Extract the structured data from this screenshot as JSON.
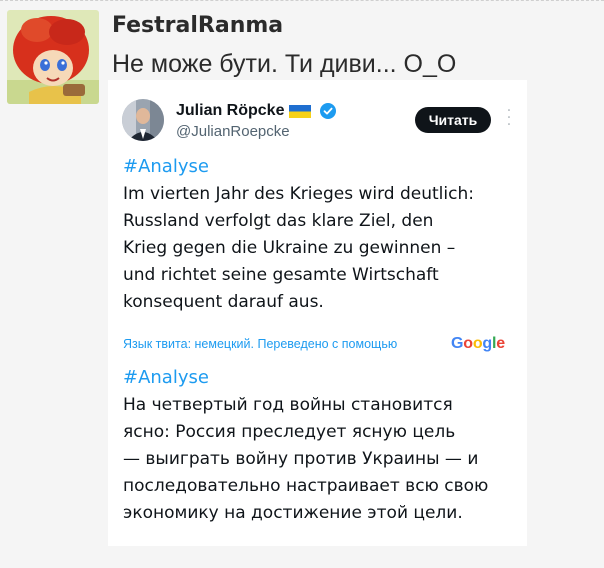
{
  "post": {
    "username": "FestralRanma",
    "message": "Не може бути. Ти диви... О_О"
  },
  "tweet": {
    "author_name": "Julian Röpcke",
    "author_handle": "@JulianRoepcke",
    "read_button_label": "Читать",
    "original_hashtag": "#Analyse",
    "original_lines": [
      "Im vierten Jahr des Krieges wird deutlich:",
      "Russland verfolgt das klare Ziel, den",
      "Krieg gegen die Ukraine zu gewinnen –",
      "und richtet seine gesamte Wirtschaft",
      "konsequent darauf aus."
    ],
    "translation_note": "Язык твита: немецкий. Переведено с помощью",
    "translation_provider": "Google",
    "translated_hashtag": "#Analyse",
    "translated_lines": [
      "На четвертый год войны становится",
      "ясно: Россия преследует ясную цель",
      "— выиграть войну против Украины — и",
      "последовательно настраивает всю свою",
      "экономику на достижение этой цели."
    ]
  }
}
